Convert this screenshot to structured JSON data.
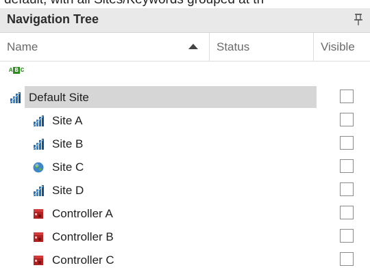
{
  "top_strip_text": "default, with all Sites/Keywords grouped at th",
  "panel": {
    "title": "Navigation Tree",
    "pin_icon": "pin-icon"
  },
  "columns": {
    "name": "Name",
    "status": "Status",
    "visible": "Visible"
  },
  "sort": {
    "column": "Name",
    "direction": "ascending"
  },
  "abc_toggle": {
    "left": "A",
    "middle": "B",
    "right": "C",
    "icon": "abc-sort-icon"
  },
  "tree": [
    {
      "label": "Default Site",
      "icon": "site-chart-icon",
      "level": 0,
      "selected": true,
      "visible": false
    },
    {
      "label": "Site A",
      "icon": "site-chart-icon",
      "level": 1,
      "selected": false,
      "visible": false
    },
    {
      "label": "Site B",
      "icon": "site-chart-icon",
      "level": 1,
      "selected": false,
      "visible": false
    },
    {
      "label": "Site C",
      "icon": "globe-icon",
      "level": 1,
      "selected": false,
      "visible": false
    },
    {
      "label": "Site D",
      "icon": "site-chart-icon",
      "level": 1,
      "selected": false,
      "visible": false
    },
    {
      "label": "Controller A",
      "icon": "controller-icon",
      "level": 1,
      "selected": false,
      "visible": false
    },
    {
      "label": "Controller B",
      "icon": "controller-icon",
      "level": 1,
      "selected": false,
      "visible": false
    },
    {
      "label": "Controller C",
      "icon": "controller-icon",
      "level": 1,
      "selected": false,
      "visible": false
    }
  ],
  "colors": {
    "header_bg": "#e9e9e9",
    "selection": "#d6d6d6",
    "site_blue": "#1a6fc4",
    "controller_red": "#b02222",
    "abc_green": "#2e8b1f"
  }
}
